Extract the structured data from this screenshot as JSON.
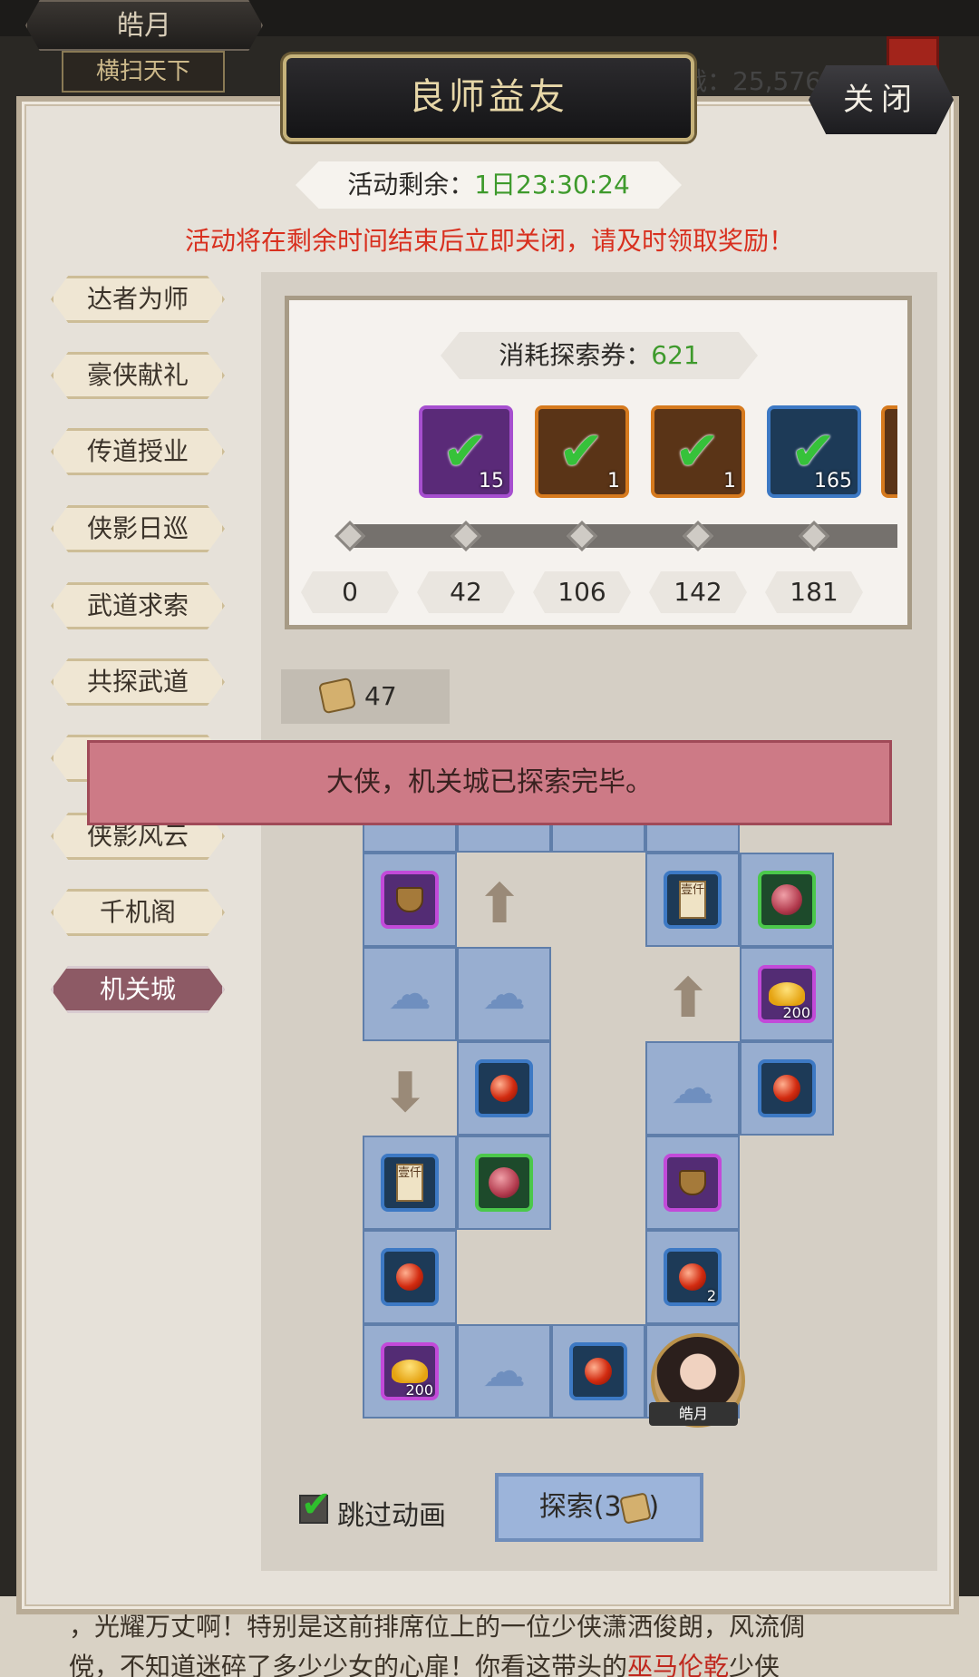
{
  "background": {
    "player_name": "皓月",
    "player_title": "横扫天下",
    "power_text": "战：25,576",
    "story_line1": "，光耀万丈啊！特别是这前排席位上的一位少侠潇洒俊朗，风流倜",
    "story_line2_a": "傥，不知道迷碎了多少少女的心扉！你看这带头的",
    "story_line2_hl": "巫马伦乾",
    "story_line2_b": "少侠"
  },
  "panel": {
    "title": "良师益友",
    "close_label": "关闭",
    "timer_label": "活动剩余：",
    "timer_value": "1日23:30:24",
    "notice": "活动将在剩余时间结束后立即关闭，请及时领取奖励！"
  },
  "nav": {
    "items": [
      {
        "label": "达者为师"
      },
      {
        "label": "豪侠献礼"
      },
      {
        "label": "传道授业"
      },
      {
        "label": "侠影日巡"
      },
      {
        "label": "武道求索"
      },
      {
        "label": "共探武道"
      },
      {
        "label": ""
      },
      {
        "label": "侠影风云"
      },
      {
        "label": "千机阁"
      },
      {
        "label": "机关城"
      }
    ],
    "active_index": 9
  },
  "progress": {
    "consume_label": "消耗探索券：",
    "consume_value": "621",
    "rewards": [
      {
        "icon": "silver-orb-icon",
        "count": "15",
        "rarity": "purple"
      },
      {
        "icon": "green-chest-icon",
        "count": "1",
        "rarity": "orange"
      },
      {
        "icon": "red-book-icon",
        "count": "1",
        "rarity": "orange"
      },
      {
        "icon": "book-icon",
        "count": "165",
        "rarity": "blue"
      }
    ],
    "thresholds": [
      "0",
      "42",
      "106",
      "142",
      "181"
    ]
  },
  "ticket_count": "47",
  "toast": "大侠，机关城已探索完毕。",
  "board": {
    "counts": {
      "orb_2": "2",
      "ingot_200_a": "200",
      "ingot_200_b": "200"
    },
    "avatar_name": "皓月",
    "scroll_glyph": "壹仟"
  },
  "controls": {
    "skip_label": "跳过动画",
    "explore_label_prefix": "探索(3",
    "explore_label_suffix": ")"
  },
  "colors": {
    "accent_green": "#3e9a2c",
    "notice_red": "#d8301f",
    "active_nav": "#8d5a65"
  }
}
